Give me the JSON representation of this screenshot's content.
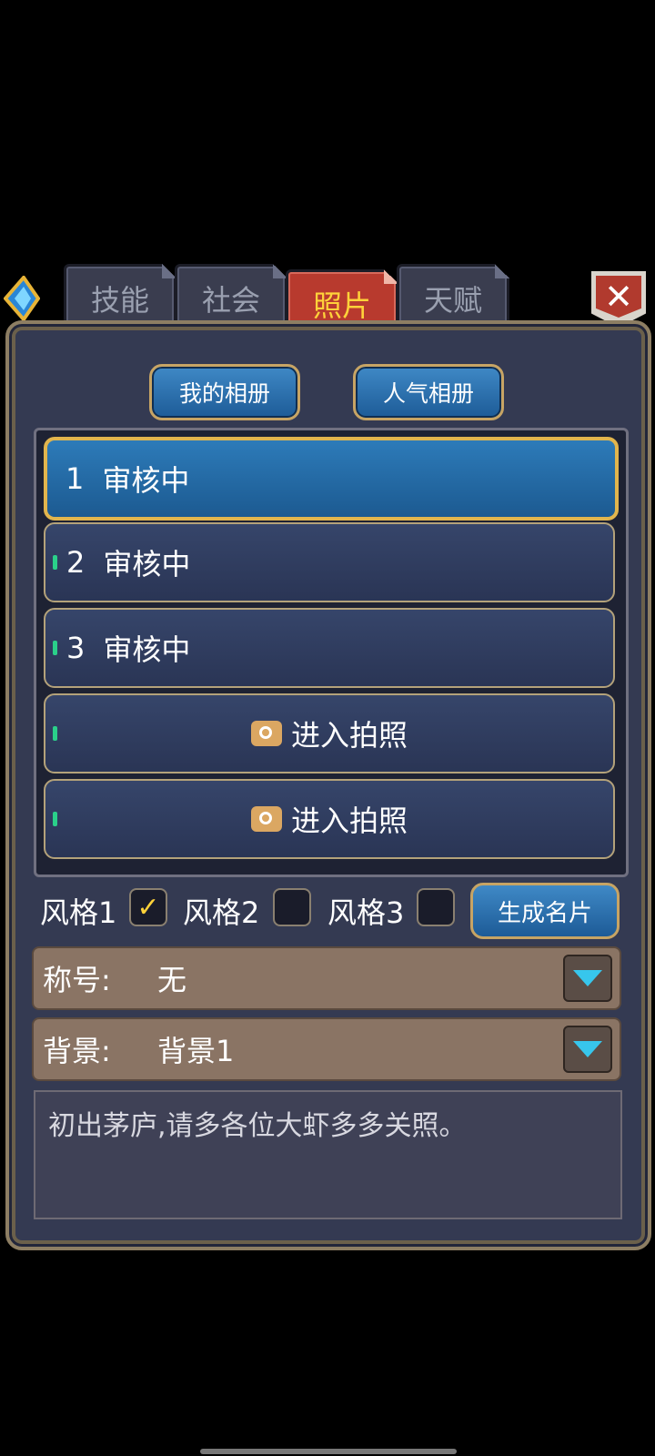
{
  "tabs": [
    "技能",
    "社会",
    "照片",
    "天赋"
  ],
  "active_tab": "照片",
  "album_buttons": {
    "my_album": "我的相册",
    "popular_album": "人气相册"
  },
  "slots": [
    {
      "num": "1",
      "status": "审核中"
    },
    {
      "num": "2",
      "status": "审核中"
    },
    {
      "num": "3",
      "status": "审核中"
    },
    {
      "action": "进入拍照"
    },
    {
      "action": "进入拍照"
    }
  ],
  "styles": [
    {
      "label": "风格1",
      "checked": true
    },
    {
      "label": "风格2",
      "checked": false
    },
    {
      "label": "风格3",
      "checked": false
    }
  ],
  "check_mark": "✓",
  "generate_button": "生成名片",
  "title_field": {
    "label": "称号:",
    "value": "无"
  },
  "background_field": {
    "label": "背景:",
    "value": "背景1"
  },
  "signature": "初出茅庐,请多各位大虾多多关照。",
  "close_glyph": "✕",
  "colors": {
    "active_tab": "#b83a2e",
    "panel": "#343a52",
    "selected_slot": "#2d7bb9",
    "accent_gold": "#e2b54d"
  }
}
